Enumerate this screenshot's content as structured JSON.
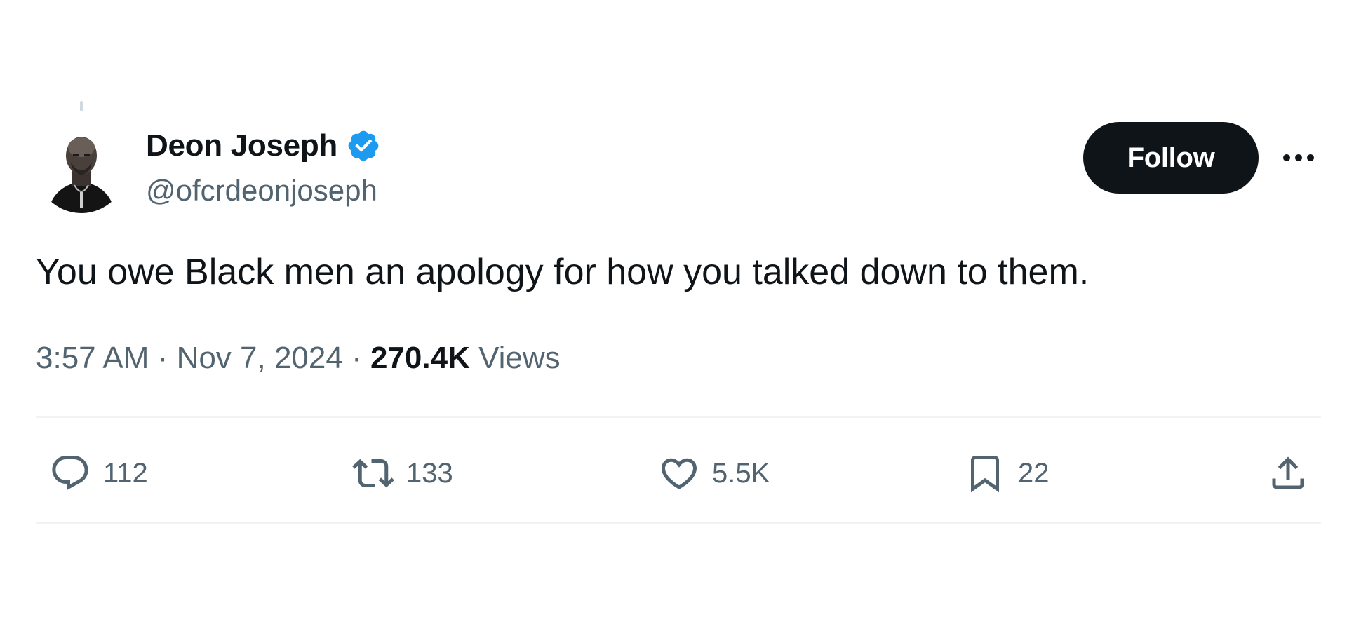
{
  "author": {
    "display_name": "Deon Joseph",
    "handle": "@ofcrdeonjoseph",
    "verified_icon": "verified-badge-icon",
    "avatar_icon": "avatar-photo"
  },
  "follow_label": "Follow",
  "more_icon": "more-options-icon",
  "tweet": {
    "text": "You owe Black men an apology for how you talked down to them.",
    "time": "3:57 AM",
    "separator": "·",
    "date": "Nov 7, 2024",
    "views_count": "270.4K",
    "views_label": "Views"
  },
  "actions": {
    "replies": "112",
    "reposts": "133",
    "likes": "5.5K",
    "bookmarks": "22"
  },
  "colors": {
    "text_primary": "#0f1419",
    "text_secondary": "#536471",
    "verified": "#1d9bf0",
    "divider": "#eff3f4",
    "follow_bg": "#0f1419"
  }
}
